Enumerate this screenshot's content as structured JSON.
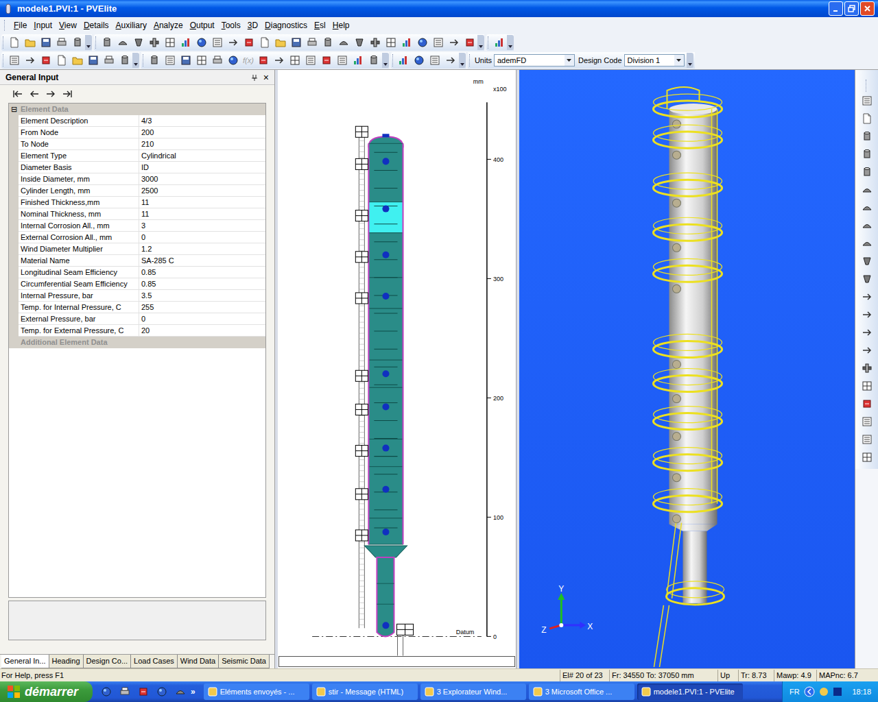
{
  "window": {
    "title": "modele1.PVI:1 - PVElite"
  },
  "menu": [
    "File",
    "Input",
    "View",
    "Details",
    "Auxiliary",
    "Analyze",
    "Output",
    "Tools",
    "3D",
    "Diagnostics",
    "Esl",
    "Help"
  ],
  "toolbar": {
    "units_label": "Units",
    "units_value": "ademFD",
    "design_code_label": "Design Code",
    "design_code_value": "Division 1",
    "formula": {
      "label": "f(x)",
      "disabled": true
    }
  },
  "panel": {
    "title": "General Input",
    "close": "×"
  },
  "property_grid": {
    "sections": [
      {
        "title": "Element Data",
        "expanded": true,
        "toggle": "⊟",
        "rows": [
          {
            "label": "Element Description",
            "value": "4/3"
          },
          {
            "label": "From Node",
            "value": "200"
          },
          {
            "label": "To Node",
            "value": "210"
          },
          {
            "label": "Element Type",
            "value": "Cylindrical"
          },
          {
            "label": "Diameter Basis",
            "value": "ID"
          },
          {
            "label": "Inside Diameter, mm",
            "value": "3000"
          },
          {
            "label": "Cylinder Length, mm",
            "value": "2500"
          },
          {
            "label": "Finished Thickness,mm",
            "value": "11"
          },
          {
            "label": "Nominal Thickness, mm",
            "value": "11"
          },
          {
            "label": "Internal Corrosion All., mm",
            "value": "3"
          },
          {
            "label": "External Corrosion All., mm",
            "value": "0"
          },
          {
            "label": "Wind Diameter Multiplier",
            "value": "1.2"
          },
          {
            "label": "Material Name",
            "value": "SA-285 C"
          },
          {
            "label": "Longitudinal Seam Efficiency",
            "value": "0.85"
          },
          {
            "label": "Circumferential Seam Efficiency",
            "value": "0.85"
          },
          {
            "label": "Internal Pressure, bar",
            "value": "3.5"
          },
          {
            "label": "Temp. for Internal Pressure, C",
            "value": "255"
          },
          {
            "label": "External Pressure, bar",
            "value": "0"
          },
          {
            "label": "Temp. for External Pressure, C",
            "value": "20"
          }
        ]
      },
      {
        "title": "Additional Element Data",
        "expanded": false,
        "rows": []
      }
    ]
  },
  "bottom_tabs": [
    {
      "label": "General In...",
      "selected": true
    },
    {
      "label": "Heading",
      "selected": false
    },
    {
      "label": "Design Co...",
      "selected": false
    },
    {
      "label": "Load Cases",
      "selected": false
    },
    {
      "label": "Wind Data",
      "selected": false
    },
    {
      "label": "Seismic Data",
      "selected": false
    }
  ],
  "drawing": {
    "unit": "mm",
    "scale": "x100",
    "ticks": [
      "400",
      "300",
      "200",
      "100",
      "0"
    ],
    "datum": "Datum",
    "shell_courses": [
      {
        "selected": false
      },
      {
        "selected": true
      },
      {
        "selected": false
      },
      {
        "selected": false
      },
      {
        "selected": false
      },
      {
        "selected": false
      },
      {
        "selected": false
      },
      {
        "selected": false
      },
      {
        "selected": false
      },
      {
        "selected": false
      }
    ]
  },
  "view3d": {
    "axes": [
      "Y",
      "X",
      "Z"
    ]
  },
  "status_bar": {
    "help": "For Help, press F1",
    "fields": [
      "El# 20 of 23",
      "Fr: 34550 To: 37050 mm",
      "Up",
      "Tr: 8.73",
      "Mawp: 4.9",
      "MAPnc: 6.7"
    ]
  },
  "taskbar": {
    "start": "démarrer",
    "overflow": "»",
    "tasks": [
      {
        "label": "Eléments envoyés - ...",
        "selected": false
      },
      {
        "label": "stir - Message (HTML)",
        "selected": false
      },
      {
        "label": "3 Explorateur Wind...",
        "selected": false
      },
      {
        "label": "3 Microsoft Office ...",
        "selected": false
      },
      {
        "label": "modele1.PVI:1 - PVElite",
        "selected": true
      }
    ],
    "language": "FR",
    "clock": "18:18"
  }
}
